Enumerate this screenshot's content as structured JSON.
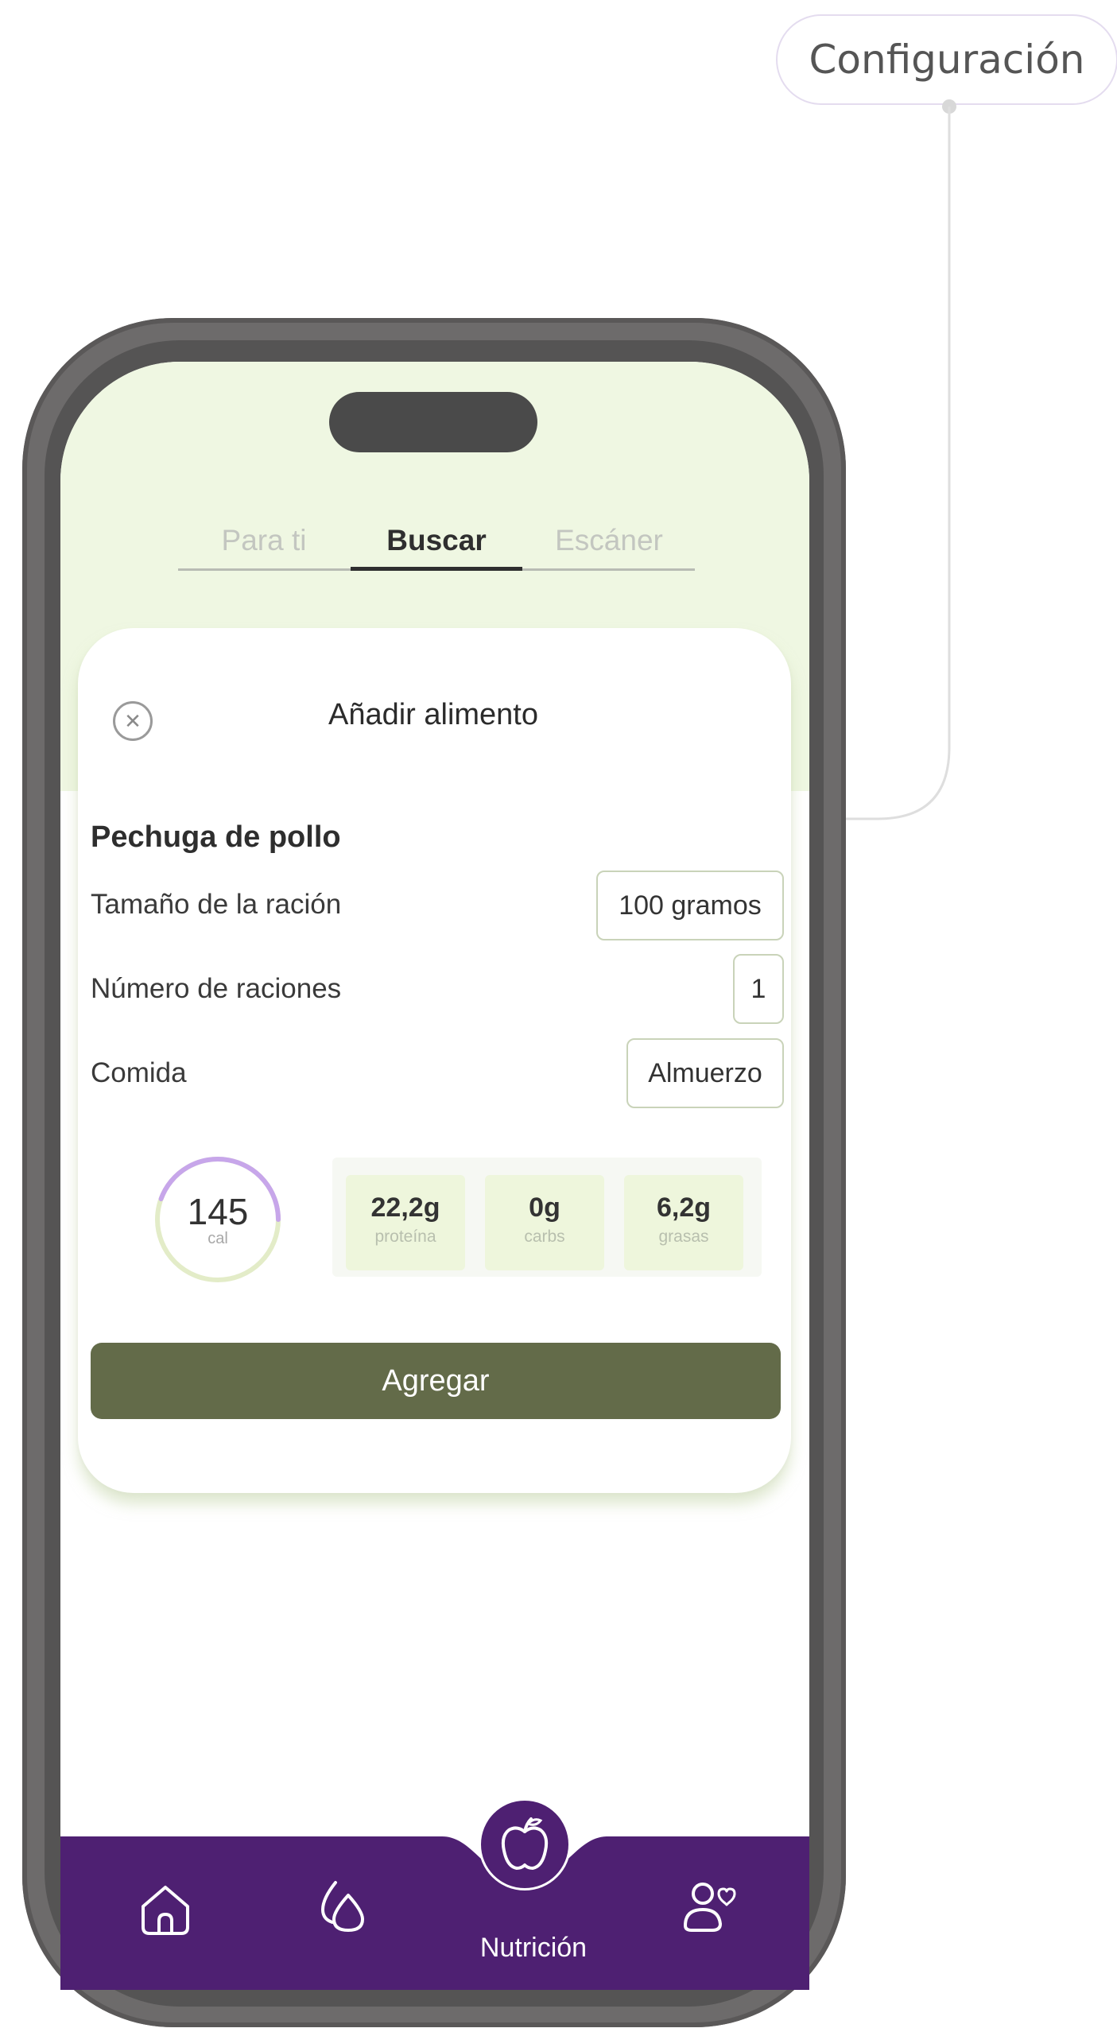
{
  "annotation": {
    "label": "Configuración"
  },
  "tabs": [
    {
      "label": "Para ti",
      "active": false
    },
    {
      "label": "Buscar",
      "active": true
    },
    {
      "label": "Escáner",
      "active": false
    }
  ],
  "dialog": {
    "title": "Añadir alimento",
    "close_icon": "close-circle-icon"
  },
  "food": {
    "name": "Pechuga de pollo",
    "serving_size": {
      "label": "Tamaño de la ración",
      "value": "100 gramos"
    },
    "servings": {
      "label": "Número de raciones",
      "value": "1"
    },
    "meal": {
      "label": "Comida",
      "value": "Almuerzo"
    }
  },
  "nutrition": {
    "calories": {
      "value": "145",
      "unit": "cal"
    },
    "macros": [
      {
        "value": "22,2g",
        "label": "proteína"
      },
      {
        "value": "0g",
        "label": "carbs"
      },
      {
        "value": "6,2g",
        "label": "grasas"
      }
    ]
  },
  "actions": {
    "add_label": "Agregar"
  },
  "bottom_nav": {
    "items": [
      {
        "icon": "home-icon"
      },
      {
        "icon": "water-drops-icon"
      },
      {
        "icon": "apple-icon",
        "label": "Nutrición",
        "active": true
      },
      {
        "icon": "profile-heart-icon"
      }
    ]
  },
  "colors": {
    "accent_purple": "#4e2072",
    "button_olive": "#636b49",
    "screen_top_tint": "#eff7e2",
    "ring_purple": "#c7a6ea",
    "ring_green": "#e3ecc8"
  }
}
